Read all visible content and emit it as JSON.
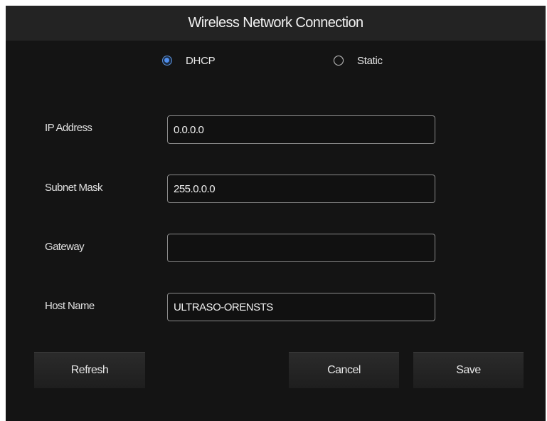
{
  "dialog": {
    "title": "Wireless Network Connection"
  },
  "mode": {
    "selected": "DHCP",
    "options": [
      {
        "label": "DHCP",
        "selected": true
      },
      {
        "label": "Static",
        "selected": false
      }
    ]
  },
  "fields": {
    "ip_address": {
      "label": "IP Address",
      "value": "0.0.0.0"
    },
    "subnet_mask": {
      "label": "Subnet Mask",
      "value": "255.0.0.0"
    },
    "gateway": {
      "label": "Gateway",
      "value": ""
    },
    "host_name": {
      "label": "Host Name",
      "value": "ULTRASO-ORENSTS"
    }
  },
  "buttons": {
    "refresh": "Refresh",
    "cancel": "Cancel",
    "save": "Save"
  },
  "colors": {
    "background": "#141414",
    "title_bar": "#232323",
    "accent": "#4f8ff0"
  }
}
